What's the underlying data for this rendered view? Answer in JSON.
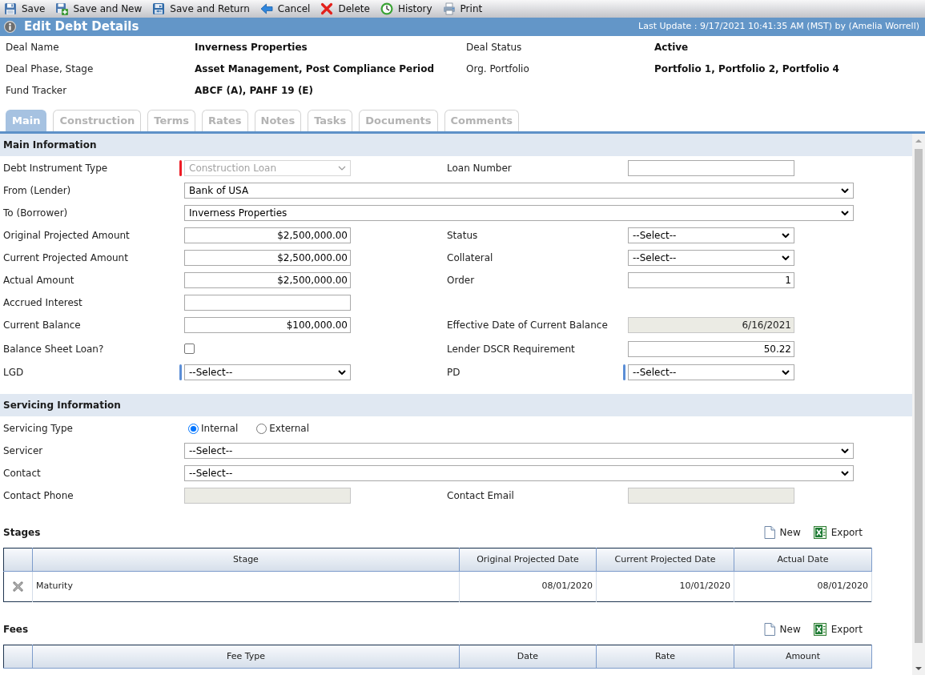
{
  "toolbar": [
    {
      "kind": "save",
      "label": "Save"
    },
    {
      "kind": "save_new",
      "label": "Save and New"
    },
    {
      "kind": "save_return",
      "label": "Save and Return"
    },
    {
      "kind": "cancel",
      "label": "Cancel"
    },
    {
      "kind": "delete",
      "label": "Delete"
    },
    {
      "kind": "history",
      "label": "History"
    },
    {
      "kind": "print",
      "label": "Print"
    }
  ],
  "header": {
    "title": "Edit Debt Details",
    "last_update": "Last Update : 9/17/2021 10:41:35 AM (MST) by (Amelia Worrell)"
  },
  "deal_info": [
    {
      "label": "Deal Name",
      "value": "Inverness Properties"
    },
    {
      "label": "Deal Status",
      "value": "Active"
    },
    {
      "label": "Deal Phase, Stage",
      "value": "Asset Management, Post Compliance Period"
    },
    {
      "label": "Org. Portfolio",
      "value": "Portfolio 1, Portfolio 2, Portfolio 4"
    },
    {
      "label": "Fund Tracker",
      "value": "ABCF (A), PAHF 19 (E)"
    }
  ],
  "tabs": [
    {
      "label": "Main",
      "selected": true
    },
    {
      "label": "Construction",
      "selected": false
    },
    {
      "label": "Terms",
      "selected": false
    },
    {
      "label": "Rates",
      "selected": false
    },
    {
      "label": "Notes",
      "selected": false
    },
    {
      "label": "Tasks",
      "selected": false
    },
    {
      "label": "Documents",
      "selected": false
    },
    {
      "label": "Comments",
      "selected": false
    }
  ],
  "main_information": {
    "title": "Main Information",
    "rows": [
      {
        "left": {
          "label": "Debt Instrument Type",
          "kind": "select",
          "value": "Construction Loan",
          "disabled": true,
          "color": "#ee1c25"
        },
        "right": {
          "label": "Loan Number",
          "kind": "text",
          "disabled": false
        }
      },
      {
        "full": {
          "label": "From (Lender)",
          "kind": "select",
          "value": "Bank of USA",
          "disabled": false
        }
      },
      {
        "full": {
          "label": "To (Borrower)",
          "kind": "select",
          "value": "Inverness Properties",
          "disabled": false
        }
      },
      {
        "left": {
          "label": "Original Projected Amount",
          "kind": "text",
          "value": "$2,500,000.00",
          "disabled": false
        },
        "right": {
          "label": "Status",
          "kind": "select",
          "value": "--Select--",
          "disabled": false
        }
      },
      {
        "left": {
          "label": "Current Projected Amount",
          "kind": "text",
          "value": "$2,500,000.00",
          "disabled": false
        },
        "right": {
          "label": "Collateral",
          "kind": "select",
          "value": "--Select--",
          "disabled": false
        }
      },
      {
        "left": {
          "label": "Actual Amount",
          "kind": "text",
          "value": "$2,500,000.00",
          "disabled": false
        },
        "right": {
          "label": "Order",
          "kind": "text",
          "value": "1",
          "disabled": false
        }
      },
      {
        "left": {
          "label": "Accrued Interest",
          "kind": "text",
          "disabled": false
        }
      },
      {
        "left": {
          "label": "Current Balance",
          "kind": "text",
          "value": "$100,000.00",
          "disabled": false
        },
        "right": {
          "label": "Effective Date of Current Balance",
          "kind": "text",
          "value": "6/16/2021",
          "disabled": true
        }
      },
      {
        "left": {
          "label": "Balance Sheet Loan?",
          "kind": "checkbox",
          "checked": false,
          "disabled": false
        },
        "right": {
          "label": "Lender DSCR Requirement",
          "kind": "text",
          "value": "50.22",
          "disabled": false
        }
      },
      {
        "left": {
          "label": "LGD",
          "kind": "select",
          "value": "--Select--",
          "disabled": false,
          "color": "#5b8ed6"
        },
        "right": {
          "label": "PD",
          "kind": "select",
          "value": "--Select--",
          "disabled": false,
          "color": "#5b8ed6"
        }
      }
    ]
  },
  "servicing_information": {
    "title": "Servicing Information",
    "rows": [
      {
        "left": {
          "label": "Servicing Type",
          "kind": "radio",
          "disabled": false,
          "options": [
            {
              "label": "Internal",
              "selected": true
            },
            {
              "label": "External",
              "selected": false
            }
          ]
        }
      },
      {
        "full": {
          "label": "Servicer",
          "kind": "select",
          "value": "--Select--",
          "disabled": false
        }
      },
      {
        "full": {
          "label": "Contact",
          "kind": "select",
          "value": "--Select--",
          "disabled": false
        }
      },
      {
        "left": {
          "label": "Contact Phone",
          "kind": "text",
          "disabled": true
        },
        "right": {
          "label": "Contact Email",
          "kind": "text",
          "disabled": true
        }
      }
    ]
  },
  "stages": {
    "title": "Stages",
    "actions": [
      {
        "kind": "new",
        "label": "New"
      },
      {
        "kind": "export",
        "label": "Export"
      }
    ],
    "columns": [
      "Stage",
      "Original Projected Date",
      "Current Projected Date",
      "Actual Date"
    ],
    "rows": [
      {
        "cells": [
          "Maturity",
          "08/01/2020",
          "10/01/2020",
          "08/01/2020"
        ]
      }
    ]
  },
  "fees": {
    "title": "Fees",
    "actions": [
      {
        "kind": "new",
        "label": "New"
      },
      {
        "kind": "export",
        "label": "Export"
      }
    ],
    "columns": [
      "Fee Type",
      "Date",
      "Rate",
      "Amount"
    ]
  }
}
